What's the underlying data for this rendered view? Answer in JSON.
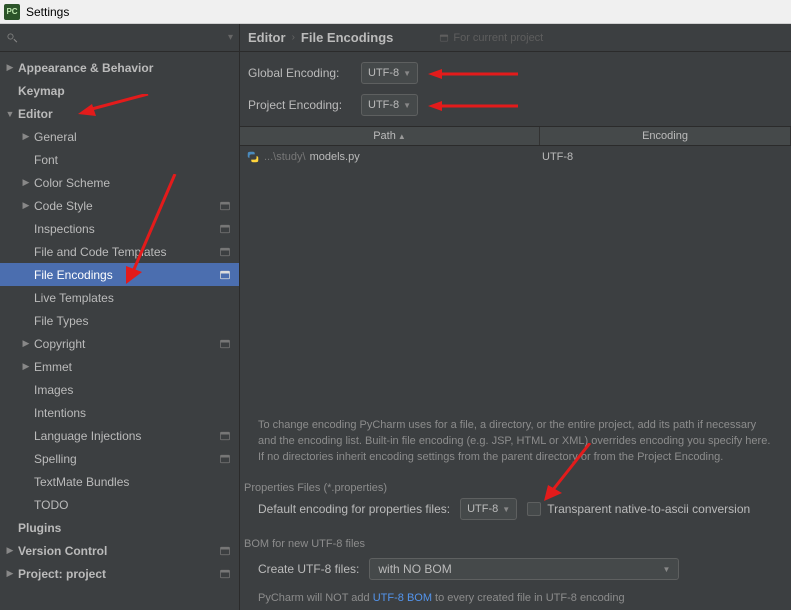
{
  "window": {
    "title": "Settings"
  },
  "search": {
    "placeholder": ""
  },
  "tree": {
    "appearance": "Appearance & Behavior",
    "keymap": "Keymap",
    "editor": "Editor",
    "general": "General",
    "font": "Font",
    "color_scheme": "Color Scheme",
    "code_style": "Code Style",
    "inspections": "Inspections",
    "templates": "File and Code Templates",
    "encodings": "File Encodings",
    "live_templates": "Live Templates",
    "file_types": "File Types",
    "copyright": "Copyright",
    "emmet": "Emmet",
    "images": "Images",
    "intentions": "Intentions",
    "lang_inj": "Language Injections",
    "spelling": "Spelling",
    "textmate": "TextMate Bundles",
    "todo": "TODO",
    "plugins": "Plugins",
    "vcs": "Version Control",
    "project": "Project: project"
  },
  "breadcrumb": {
    "a": "Editor",
    "b": "File Encodings",
    "proj": "For current project"
  },
  "form": {
    "global_label": "Global Encoding:",
    "global_value": "UTF-8",
    "project_label": "Project Encoding:",
    "project_value": "UTF-8"
  },
  "table": {
    "path_header": "Path",
    "enc_header": "Encoding",
    "row_dim": "...\\study\\",
    "row_name": "models.py",
    "row_enc": "UTF-8"
  },
  "hint": "To change encoding PyCharm uses for a file, a directory, or the entire project, add its path if necessary and the encoding list. Built-in file encoding (e.g. JSP, HTML or XML) overrides encoding you specify here. If no directories inherit encoding settings from the parent directory or from the Project Encoding.",
  "properties": {
    "section": "Properties Files (*.properties)",
    "label": "Default encoding for properties files:",
    "value": "UTF-8",
    "checkbox": "Transparent native-to-ascii conversion"
  },
  "bom": {
    "section": "BOM for new UTF-8 files",
    "label": "Create UTF-8 files:",
    "value": "with NO BOM",
    "hint_a": "PyCharm will NOT add ",
    "hint_link": "UTF-8 BOM",
    "hint_b": " to every created file in UTF-8 encoding"
  }
}
